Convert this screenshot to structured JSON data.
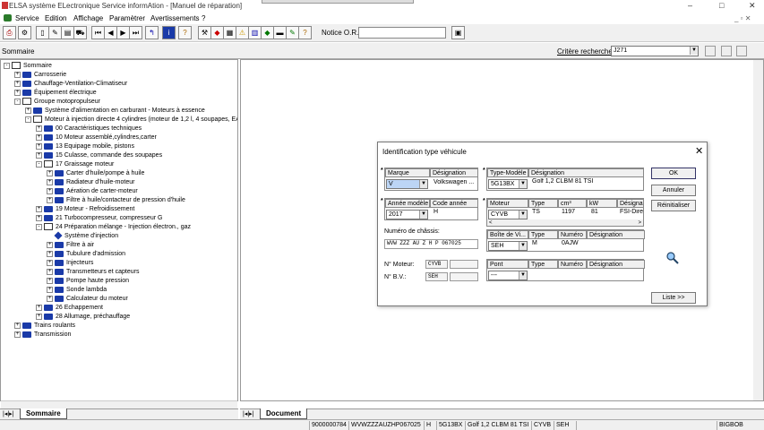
{
  "window": {
    "title": "ELSA système ELectronique Service informAtion - [Manuel de réparation]"
  },
  "menu": [
    "Service",
    "Edition",
    "Affichage",
    "Paramètrer",
    "Avertissements",
    "?"
  ],
  "toolbar": {
    "notice_label": "Notice O.R.:",
    "notice_value": ""
  },
  "summary": {
    "title": "Sommaire",
    "criteria_label": "Critère recherche:",
    "criteria_value": "J271"
  },
  "tree": [
    {
      "label": "Sommaire",
      "level": 0,
      "exp": "-",
      "type": "bko"
    },
    {
      "label": "Carrosserie",
      "level": 1,
      "exp": "+",
      "type": "bk"
    },
    {
      "label": "Chauffage-Ventilation-Climatiseur",
      "level": 1,
      "exp": "+",
      "type": "bk"
    },
    {
      "label": "Équipement électrique",
      "level": 1,
      "exp": "+",
      "type": "bk"
    },
    {
      "label": "Groupe motopropulseur",
      "level": 1,
      "exp": "-",
      "type": "bko"
    },
    {
      "label": "Système d'alimentation en carburant - Moteurs à essence",
      "level": 2,
      "exp": "+",
      "type": "bk"
    },
    {
      "label": "Moteur à injection directe 4 cylindres (moteur de 1,2 l, 4 soupapes, EA 2",
      "level": 2,
      "exp": "-",
      "type": "bko"
    },
    {
      "label": "00 Caractéristiques techniques",
      "level": 3,
      "exp": "+",
      "type": "bk"
    },
    {
      "label": "10 Moteur assemblé,cylindres,carter",
      "level": 3,
      "exp": "+",
      "type": "bk"
    },
    {
      "label": "13 Equipage mobile, pistons",
      "level": 3,
      "exp": "+",
      "type": "bk"
    },
    {
      "label": "15 Culasse, commande des soupapes",
      "level": 3,
      "exp": "+",
      "type": "bk"
    },
    {
      "label": "17 Graissage moteur",
      "level": 3,
      "exp": "-",
      "type": "bko"
    },
    {
      "label": "Carter d'huile/pompe à huile",
      "level": 4,
      "exp": "+",
      "type": "bk"
    },
    {
      "label": "Radiateur d'huile-moteur",
      "level": 4,
      "exp": "+",
      "type": "bk"
    },
    {
      "label": "Aération de carter-moteur",
      "level": 4,
      "exp": "+",
      "type": "bk"
    },
    {
      "label": "Filtre à huile/contacteur de pression d'huile",
      "level": 4,
      "exp": "+",
      "type": "bk"
    },
    {
      "label": "19 Moteur - Refroidissement",
      "level": 3,
      "exp": "+",
      "type": "bk"
    },
    {
      "label": "21 Turbocompresseur, compresseur G",
      "level": 3,
      "exp": "+",
      "type": "bk"
    },
    {
      "label": "24 Préparation mélange - Injection électron., gaz",
      "level": 3,
      "exp": "-",
      "type": "bko"
    },
    {
      "label": "Système d'injection",
      "level": 4,
      "exp": "",
      "type": "doc"
    },
    {
      "label": "Filtre à air",
      "level": 4,
      "exp": "+",
      "type": "bk"
    },
    {
      "label": "Tubulure d'admission",
      "level": 4,
      "exp": "+",
      "type": "bk"
    },
    {
      "label": "Injecteurs",
      "level": 4,
      "exp": "+",
      "type": "bk"
    },
    {
      "label": "Transmetteurs et capteurs",
      "level": 4,
      "exp": "+",
      "type": "bk"
    },
    {
      "label": "Pompe haute pression",
      "level": 4,
      "exp": "+",
      "type": "bk"
    },
    {
      "label": "Sonde lambda",
      "level": 4,
      "exp": "+",
      "type": "bk"
    },
    {
      "label": "Calculateur du moteur",
      "level": 4,
      "exp": "+",
      "type": "bk"
    },
    {
      "label": "26 Echappement",
      "level": 3,
      "exp": "+",
      "type": "bk"
    },
    {
      "label": "28 Allumage, préchauffage",
      "level": 3,
      "exp": "+",
      "type": "bk"
    },
    {
      "label": "Trains roulants",
      "level": 1,
      "exp": "+",
      "type": "bk"
    },
    {
      "label": "Transmission",
      "level": 1,
      "exp": "+",
      "type": "bk"
    }
  ],
  "tabs": {
    "left": "Sommaire",
    "right": "Document"
  },
  "status": [
    "9000000784",
    "WVWZZZAUZHP067025",
    "H",
    "5G13BX",
    "Golf 1,2 CLBM 81 TSI",
    "CYVB",
    "SEH",
    "",
    "BIGBOB"
  ],
  "dialog": {
    "title": "Identification type véhicule",
    "marque": {
      "h1": "Marque",
      "h2": "Désignation",
      "sel": "V",
      "des": "Volkswagen ..."
    },
    "type": {
      "h1": "Type-Modèle",
      "h2": "Désignation",
      "sel": "5G13BX",
      "des": "Golf 1,2 CLBM 81 TSI"
    },
    "annee": {
      "h1": "Année modèle",
      "h2": "Code année",
      "sel": "2017",
      "code": "H"
    },
    "moteur": {
      "headers": [
        "Moteur",
        "Type",
        "cm³",
        "kW",
        "Désigna"
      ],
      "sel": "CYVB",
      "type": "TS",
      "cm3": "1197",
      "kw": "81",
      "des": "FSI-Dire"
    },
    "chassis_label": "Numéro de châssis:",
    "chassis": "WVW ZZZ AU Z H P 067025",
    "boite": {
      "headers": [
        "Boîte de Vi...",
        "Type",
        "Numéro",
        "Désignation"
      ],
      "sel": "SEH",
      "type": "M",
      "num": "0AJW"
    },
    "nmoteur_label": "N° Moteur:",
    "nmoteur": "CYVB",
    "nbv_label": "N° B.V.:",
    "nbv": "SEH",
    "pont": {
      "headers": [
        "Pont",
        "Type",
        "Numéro",
        "Désignation"
      ],
      "sel": "---"
    },
    "buttons": {
      "ok": "OK",
      "cancel": "Annuler",
      "reset": "Réinitialiser",
      "list": "Liste >>"
    }
  }
}
